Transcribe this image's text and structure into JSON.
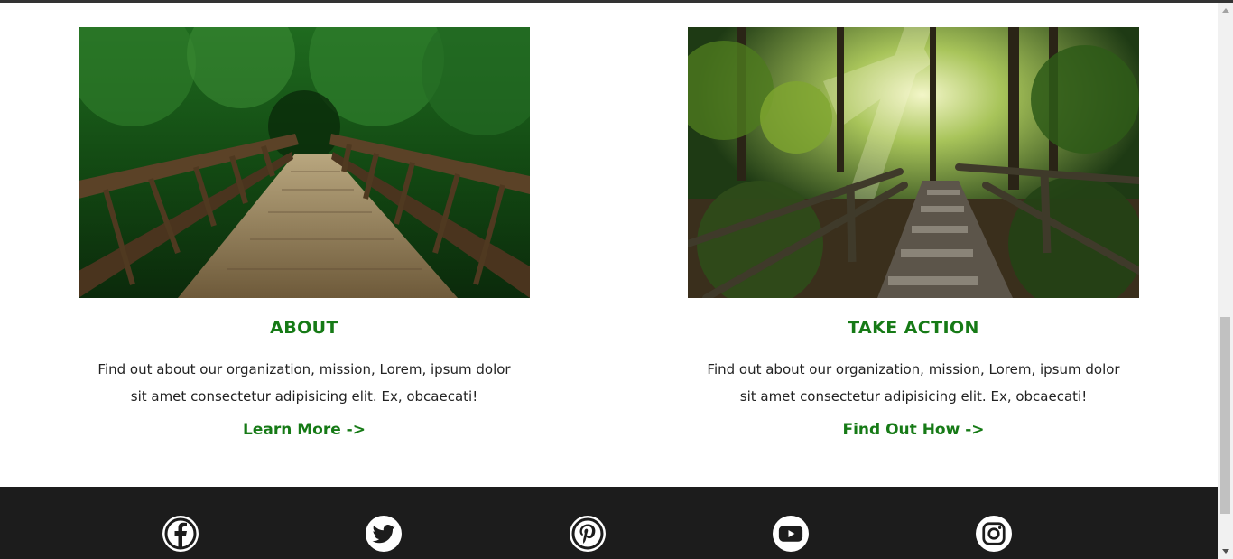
{
  "theme": {
    "accent_green": "#167a16",
    "footer_bg": "#1c1c1c",
    "text_dark": "#222222"
  },
  "cards": [
    {
      "image": "forest-bridge-photo",
      "title": "ABOUT",
      "text": "Find out about our organization, mission, Lorem, ipsum dolor sit amet consectetur adipisicing elit. Ex, obcaecati!",
      "link_label": "Learn More ->"
    },
    {
      "image": "forest-path-sunbeams-photo",
      "title": "TAKE ACTION",
      "text": "Find out about our organization, mission, Lorem, ipsum dolor sit amet consectetur adipisicing elit. Ex, obcaecati!",
      "link_label": "Find Out How ->"
    }
  ],
  "footer": {
    "social_icons": [
      "facebook-icon",
      "twitter-icon",
      "pinterest-icon",
      "youtube-icon",
      "instagram-icon"
    ]
  }
}
